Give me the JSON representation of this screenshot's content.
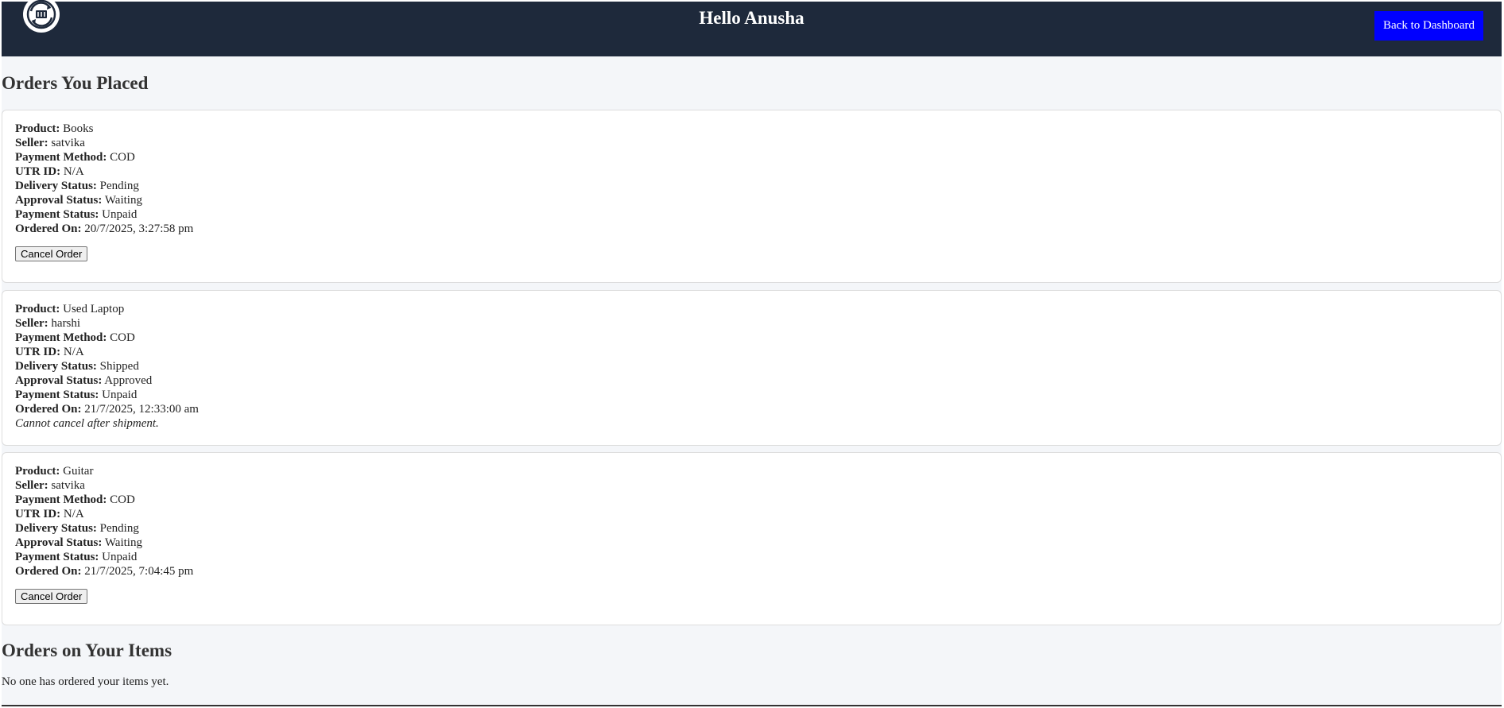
{
  "header": {
    "logo_icon": "recycle-globe-logo-icon",
    "greeting": "Hello Anusha",
    "back_button": "Back to Dashboard",
    "colors": {
      "background": "#1e293b",
      "button": "#0000ff"
    }
  },
  "placed": {
    "title": "Orders You Placed",
    "labels": {
      "product": "Product:",
      "seller": "Seller:",
      "payment_method": "Payment Method:",
      "utr": "UTR ID:",
      "delivery": "Delivery Status:",
      "approval": "Approval Status:",
      "payment_status": "Payment Status:",
      "ordered_on": "Ordered On:"
    },
    "orders": [
      {
        "product": "Books",
        "seller": "satvika",
        "payment_method": "COD",
        "utr": "N/A",
        "delivery": "Pending",
        "approval": "Waiting",
        "payment_status": "Unpaid",
        "ordered_on": "20/7/2025, 3:27:58 pm",
        "action": "Cancel Order"
      },
      {
        "product": "Used Laptop",
        "seller": "harshi",
        "payment_method": "COD",
        "utr": "N/A",
        "delivery": "Shipped",
        "approval": "Approved",
        "payment_status": "Unpaid",
        "ordered_on": "21/7/2025, 12:33:00 am",
        "note": "Cannot cancel after shipment."
      },
      {
        "product": "Guitar",
        "seller": "satvika",
        "payment_method": "COD",
        "utr": "N/A",
        "delivery": "Pending",
        "approval": "Waiting",
        "payment_status": "Unpaid",
        "ordered_on": "21/7/2025, 7:04:45 pm",
        "action": "Cancel Order"
      }
    ]
  },
  "received": {
    "title": "Orders on Your Items",
    "empty_text": "No one has ordered your items yet."
  }
}
